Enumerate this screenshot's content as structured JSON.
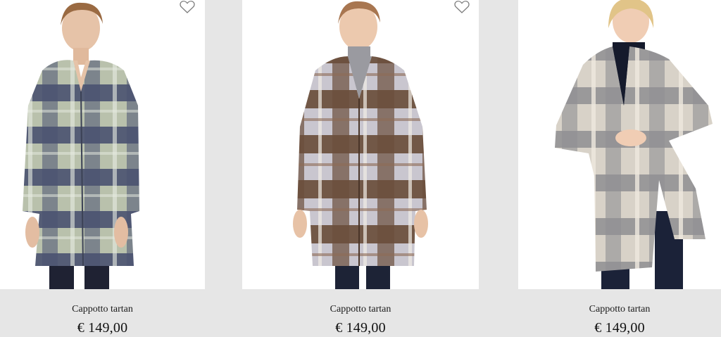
{
  "products": [
    {
      "name": "Cappotto tartan",
      "price": "€ 149,00",
      "coat_colors": {
        "dark": "#4a5270",
        "light": "#b9c1ac",
        "mid": "#6e7a74"
      }
    },
    {
      "name": "Cappotto tartan",
      "price": "€ 149,00",
      "coat_colors": {
        "dark": "#6b4e3c",
        "light": "#c9c6cf",
        "mid": "#8e6b55"
      }
    },
    {
      "name": "Cappotto tartan",
      "price": "€ 149,00",
      "coat_colors": {
        "dark": "#8f8f92",
        "light": "#d8d2c8",
        "mid": "#b2aeaa"
      }
    }
  ],
  "icons": {
    "wishlist": "heart-outline-icon"
  }
}
